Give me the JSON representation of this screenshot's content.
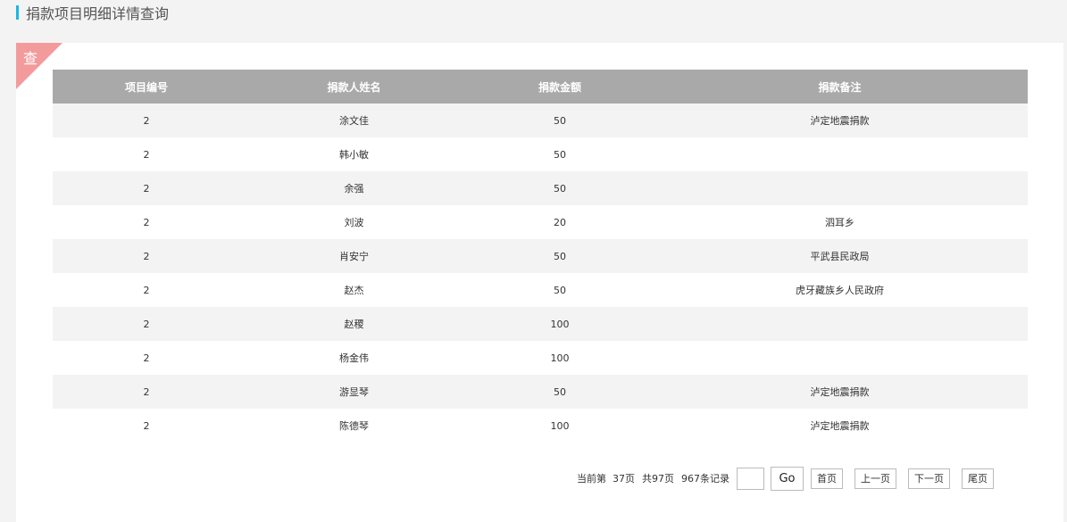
{
  "header": {
    "title": "捐款项目明细详情查询"
  },
  "panel": {
    "corner_label": "查"
  },
  "table": {
    "columns": [
      "项目编号",
      "捐款人姓名",
      "捐款金额",
      "捐款备注"
    ],
    "rows": [
      [
        "2",
        "涂文佳",
        "50",
        "泸定地震捐款"
      ],
      [
        "2",
        "韩小敏",
        "50",
        ""
      ],
      [
        "2",
        "余强",
        "50",
        ""
      ],
      [
        "2",
        "刘波",
        "20",
        "泗耳乡"
      ],
      [
        "2",
        "肖安宁",
        "50",
        "平武县民政局"
      ],
      [
        "2",
        "赵杰",
        "50",
        "虎牙藏族乡人民政府"
      ],
      [
        "2",
        "赵稷",
        "100",
        ""
      ],
      [
        "2",
        "杨金伟",
        "100",
        ""
      ],
      [
        "2",
        "游显琴",
        "50",
        "泸定地震捐款"
      ],
      [
        "2",
        "陈德琴",
        "100",
        "泸定地震捐款"
      ]
    ]
  },
  "pager": {
    "current_page_text": "当前第  37页",
    "total_pages_text": "共97页",
    "total_records_text": "967条记录",
    "goto_value": "",
    "go_label": "Go",
    "first_label": "首页",
    "prev_label": "上一页",
    "next_label": "下一页",
    "last_label": "尾页"
  },
  "colors": {
    "accent": "#19b7e3",
    "header_bg": "#a9a9a9",
    "ribbon": "#f39b9c",
    "stripe": "#f3f3f3"
  }
}
